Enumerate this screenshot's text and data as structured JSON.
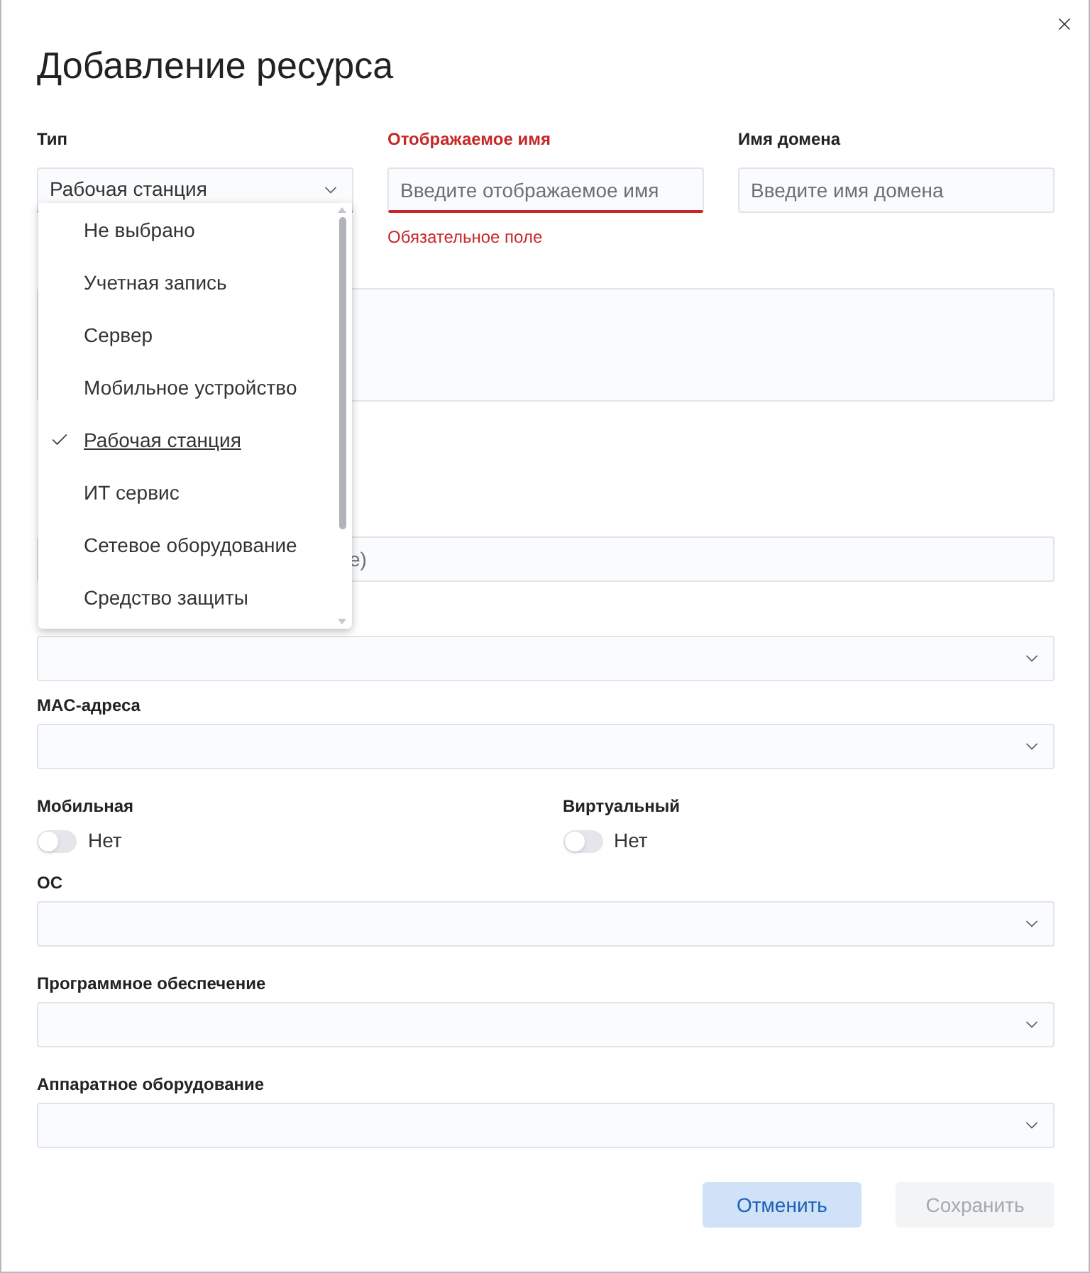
{
  "dialog": {
    "title": "Добавление ресурса"
  },
  "top_fields": [
    {
      "kind": "select",
      "label": "Тип",
      "value": "Рабочая станция",
      "focused": true
    },
    {
      "kind": "input",
      "label": "Отображаемое имя",
      "placeholder": "Введите отображаемое имя",
      "error": "Обязательное поле"
    },
    {
      "kind": "input",
      "label": "Имя домена",
      "placeholder": "Введите имя домена"
    }
  ],
  "covered_fields": [
    {
      "kind": "textarea"
    },
    {
      "kind": "input",
      "placeholder": "е)"
    },
    {
      "kind": "select"
    }
  ],
  "dropdown": {
    "options": [
      {
        "label": "Не выбрано",
        "selected": false
      },
      {
        "label": "Учетная запись",
        "selected": false
      },
      {
        "label": "Сервер",
        "selected": false
      },
      {
        "label": "Мобильное устройство",
        "selected": false
      },
      {
        "label": "Рабочая станция",
        "selected": true
      },
      {
        "label": "ИТ сервис",
        "selected": false
      },
      {
        "label": "Сетевое оборудование",
        "selected": false
      },
      {
        "label": "Средство защиты",
        "selected": false
      }
    ]
  },
  "lower_fields": [
    {
      "kind": "select",
      "label": "MAC-адреса"
    },
    {
      "kind": "toggles",
      "toggles": [
        {
          "label": "Мобильная",
          "on": false,
          "text": "Нет"
        },
        {
          "label": "Виртуальный",
          "on": false,
          "text": "Нет"
        }
      ]
    },
    {
      "kind": "select",
      "label": "ОС"
    },
    {
      "kind": "select",
      "label": "Программное обеспечение"
    },
    {
      "kind": "select",
      "label": "Аппаратное оборудование"
    }
  ],
  "buttons": [
    {
      "label": "Отменить",
      "disabled": false
    },
    {
      "label": "Сохранить",
      "disabled": true
    }
  ]
}
